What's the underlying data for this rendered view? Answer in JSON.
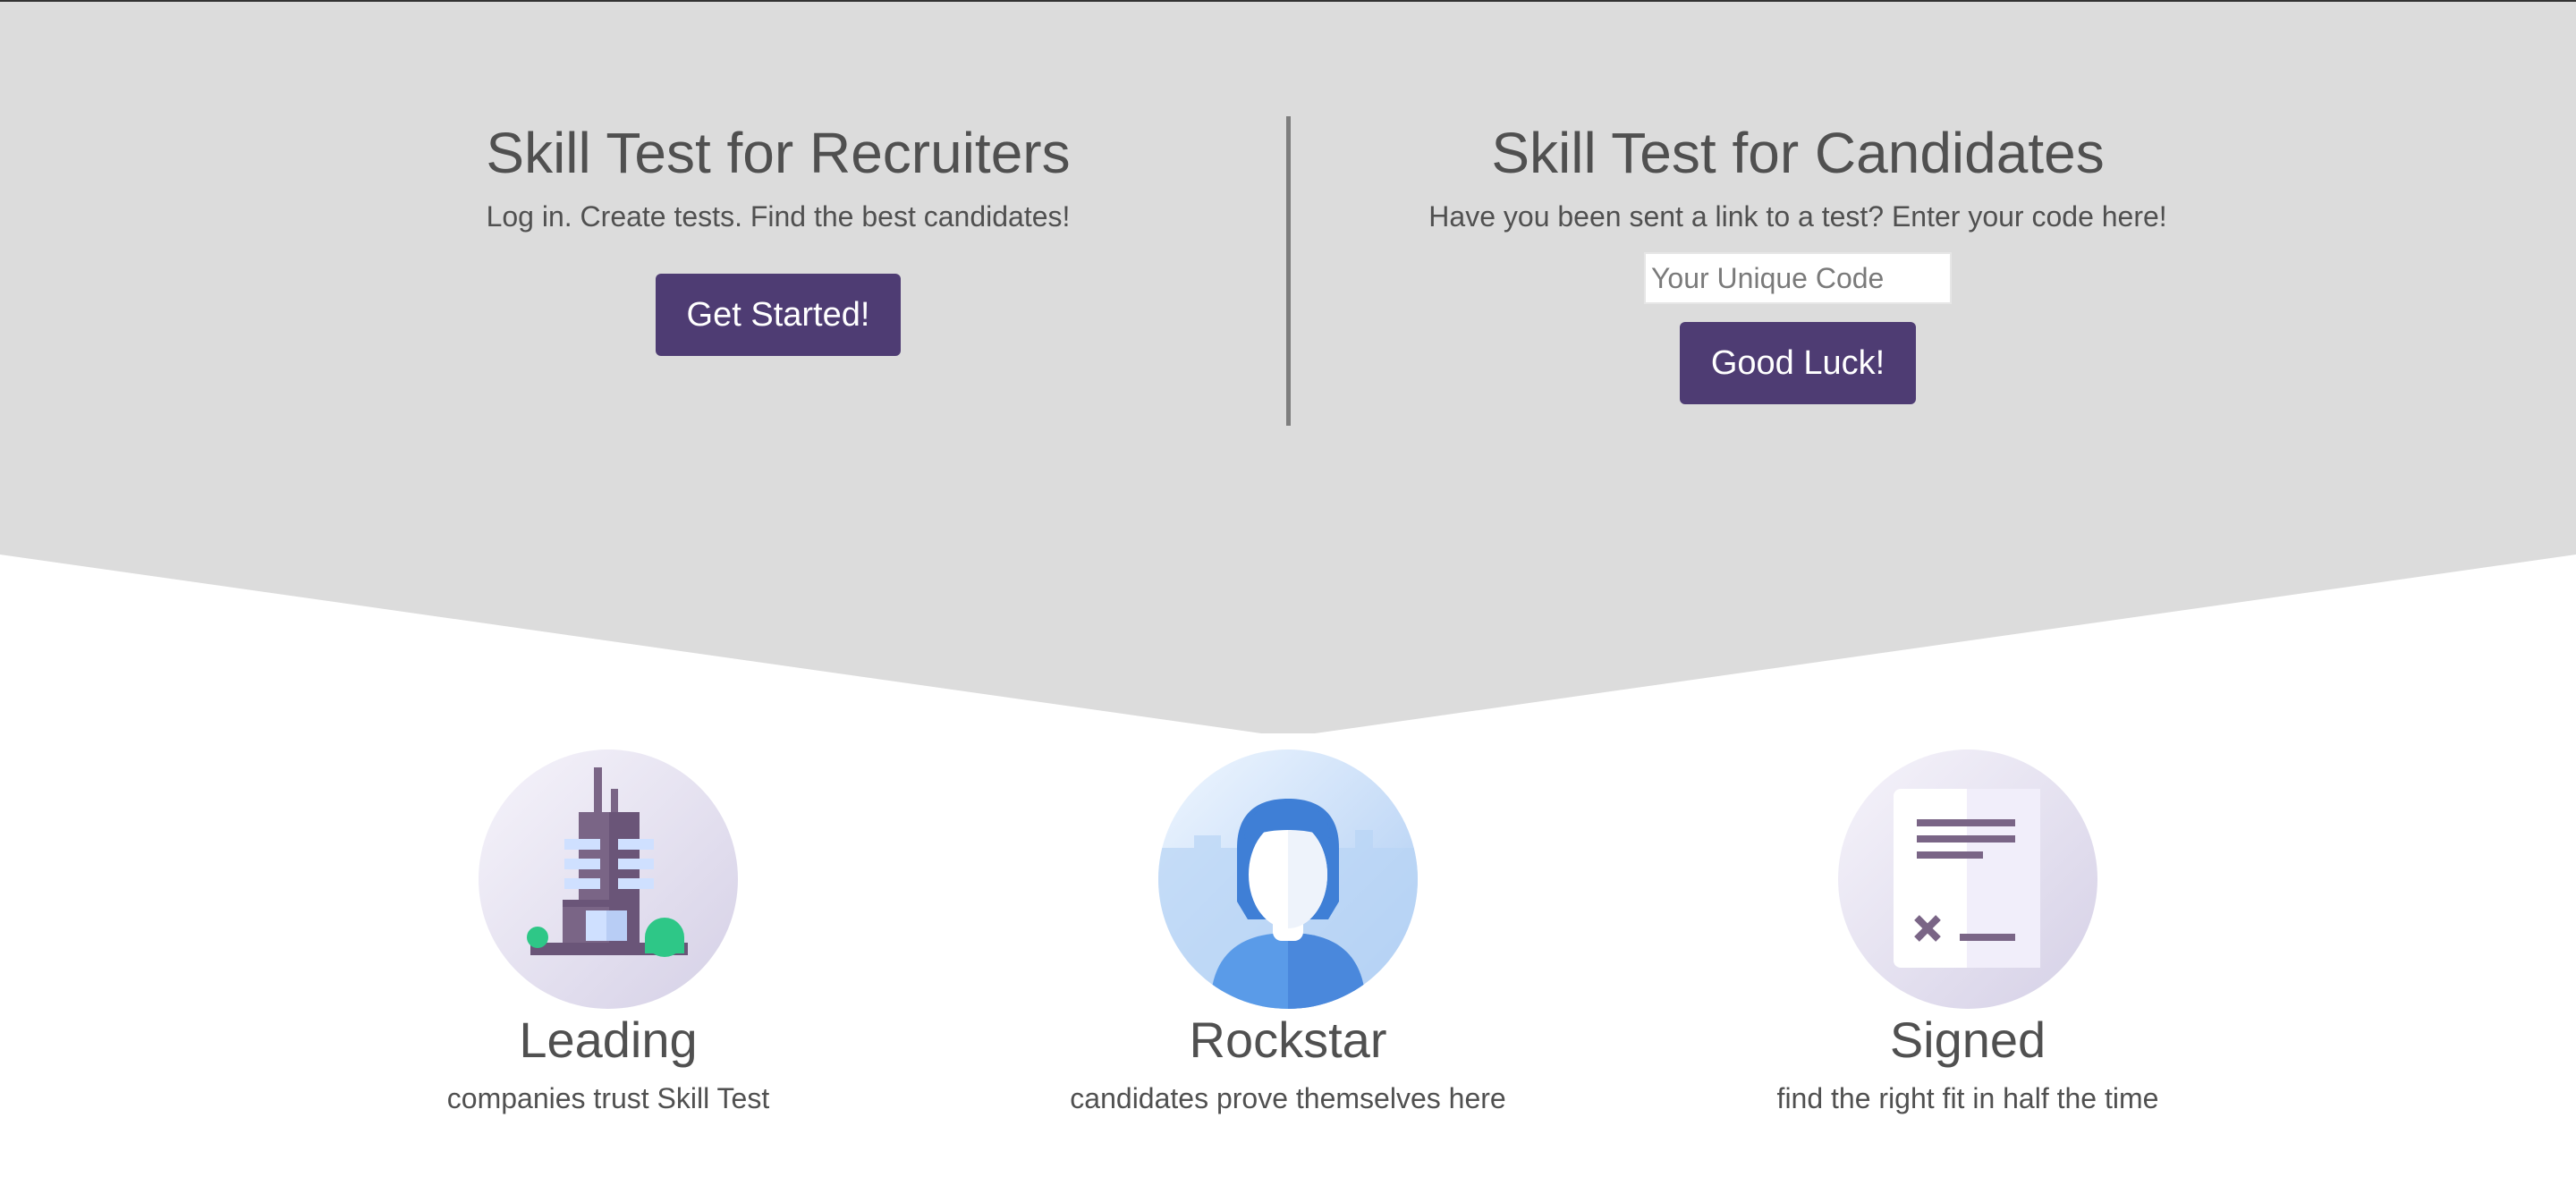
{
  "recruiters": {
    "title": "Skill Test for Recruiters",
    "subtitle": "Log in. Create tests. Find the best candidates!",
    "button_label": "Get Started!"
  },
  "candidates": {
    "title": "Skill Test for Candidates",
    "subtitle": "Have you been sent a link to a test? Enter your code here!",
    "code_placeholder": "Your Unique Code",
    "button_label": "Good Luck!"
  },
  "features": [
    {
      "title": "Leading",
      "description": "companies trust Skill Test",
      "icon": "building-icon"
    },
    {
      "title": "Rockstar",
      "description": "candidates prove themselves here",
      "icon": "person-icon"
    },
    {
      "title": "Signed",
      "description": "find the right fit in half the time",
      "icon": "contract-icon"
    }
  ],
  "colors": {
    "hero_background": "#dcdcdc",
    "button": "#4e3c73",
    "text": "#505050",
    "divider": "#7e7e7e"
  }
}
